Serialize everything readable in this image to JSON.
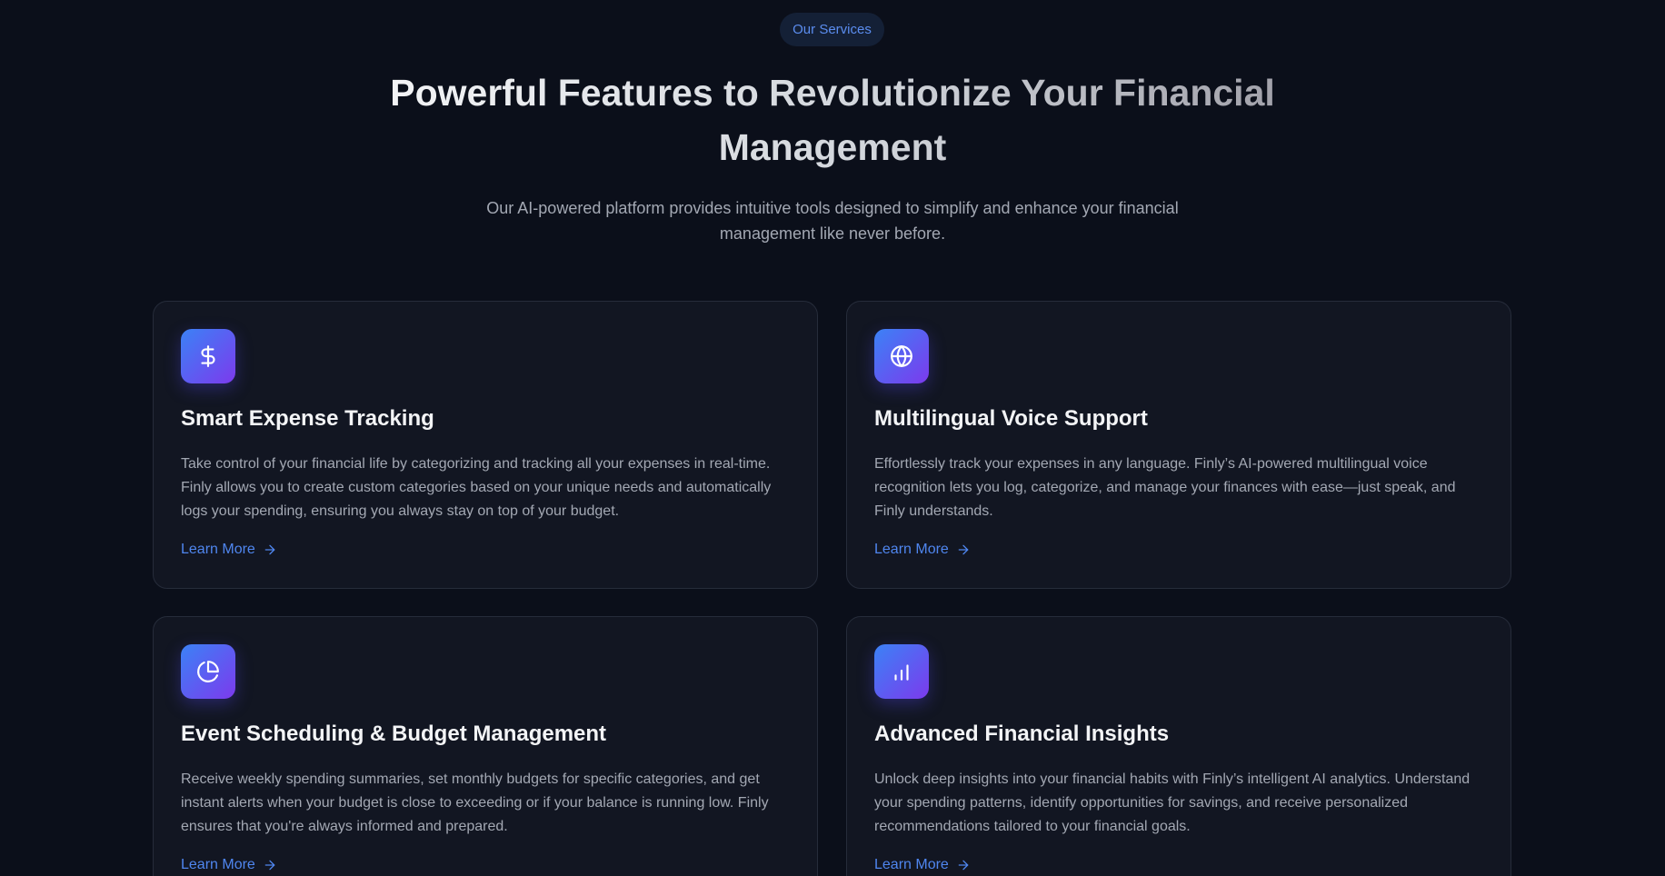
{
  "header": {
    "badge": "Our Services",
    "title": "Powerful Features to Revolutionize Your Financial Management",
    "subtitle": "Our AI-powered platform provides intuitive tools designed to simplify and enhance your financial management like never before."
  },
  "features": [
    {
      "icon": "dollar-icon",
      "title": "Smart Expense Tracking",
      "description": "Take control of your financial life by categorizing and tracking all your expenses in real-time. Finly allows you to create custom categories based on your unique needs and automatically logs your spending, ensuring you always stay on top of your budget.",
      "link": "Learn More"
    },
    {
      "icon": "globe-icon",
      "title": "Multilingual Voice Support",
      "description": "Effortlessly track your expenses in any language. Finly’s AI-powered multilingual voice recognition lets you log, categorize, and manage your finances with ease—just speak, and Finly understands.",
      "link": "Learn More"
    },
    {
      "icon": "pie-chart-icon",
      "title": "Event Scheduling & Budget Management",
      "description": "Receive weekly spending summaries, set monthly budgets for specific categories, and get instant alerts when your budget is close to exceeding or if your balance is running low. Finly ensures that you're always informed and prepared.",
      "link": "Learn More"
    },
    {
      "icon": "bar-chart-icon",
      "title": "Advanced Financial Insights",
      "description": "Unlock deep insights into your financial habits with Finly’s intelligent AI analytics. Understand your spending patterns, identify opportunities for savings, and receive personalized recommendations tailored to your financial goals.",
      "link": "Learn More"
    }
  ],
  "colors": {
    "background": "#0b0f1a",
    "card": "#121622",
    "accent": "#4f86ef",
    "icon_gradient_start": "#3b82f6",
    "icon_gradient_end": "#7c3aed"
  }
}
